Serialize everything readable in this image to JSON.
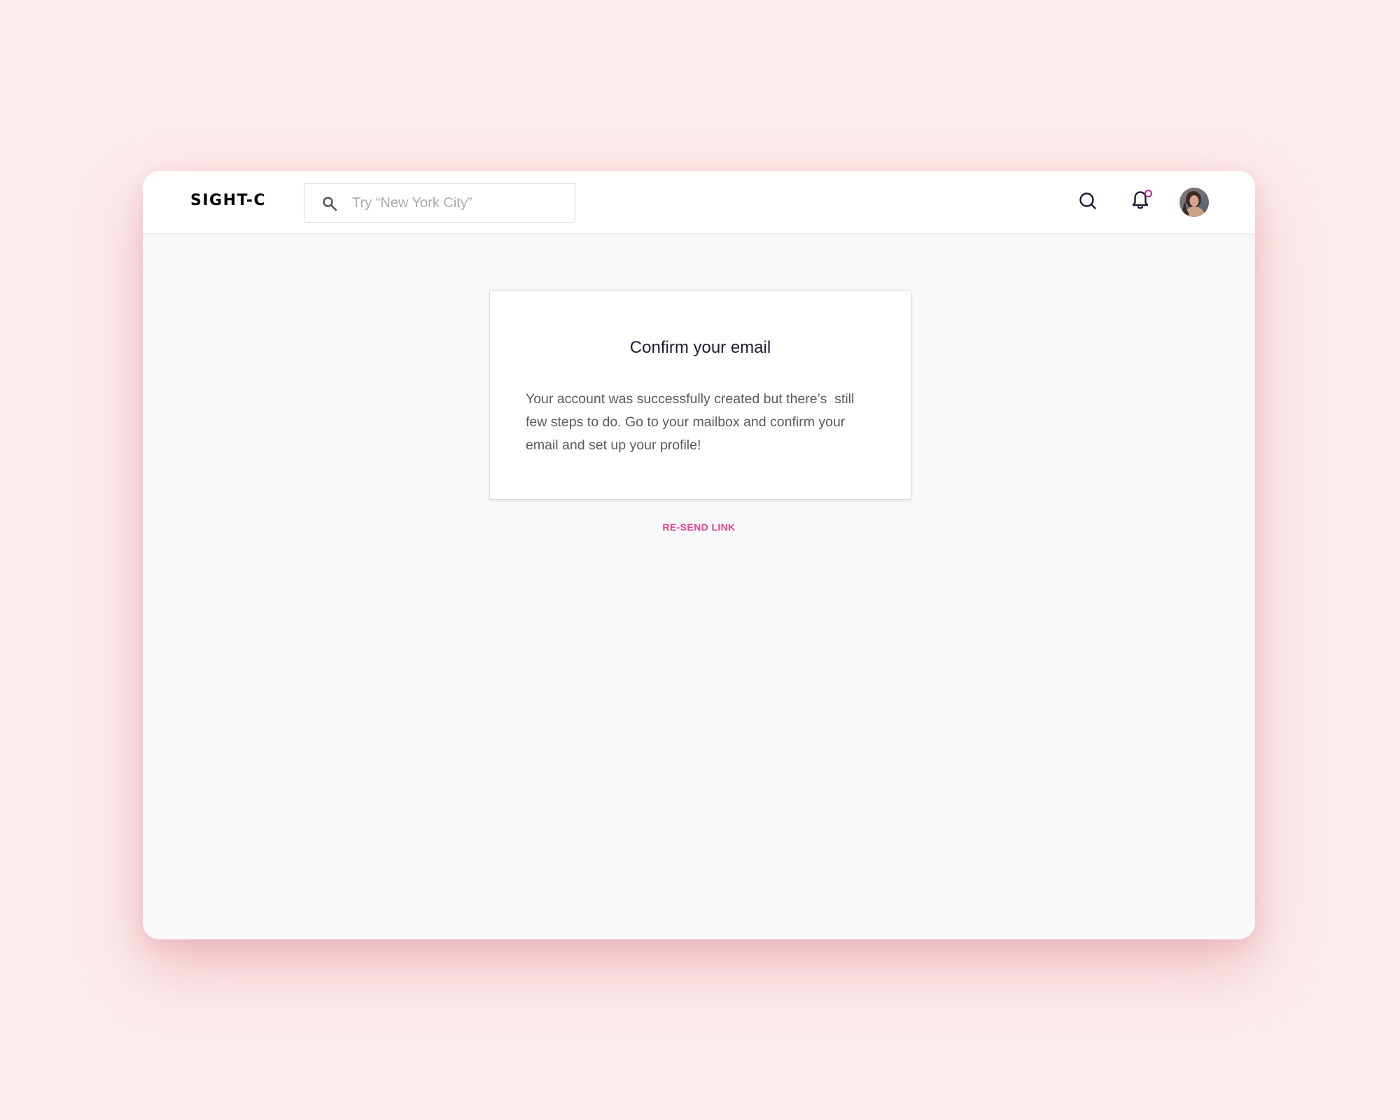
{
  "header": {
    "logo": "SIGHT-C",
    "search": {
      "placeholder": "Try “New York City”",
      "value": ""
    },
    "icons": {
      "search": "search-icon",
      "notifications": "bell-icon",
      "avatar": "user-avatar"
    },
    "notification_badge_color": "#c2279c"
  },
  "card": {
    "title": "Confirm your email",
    "body": "Your account was successfully created but there’s  still\nfew steps to do. Go to your mailbox and confirm your\nemail and set up your profile!"
  },
  "resend_link": "RE-SEND LINK",
  "colors": {
    "background": "#fdecec",
    "accent": "#e8438c",
    "title": "#1b1d35"
  }
}
